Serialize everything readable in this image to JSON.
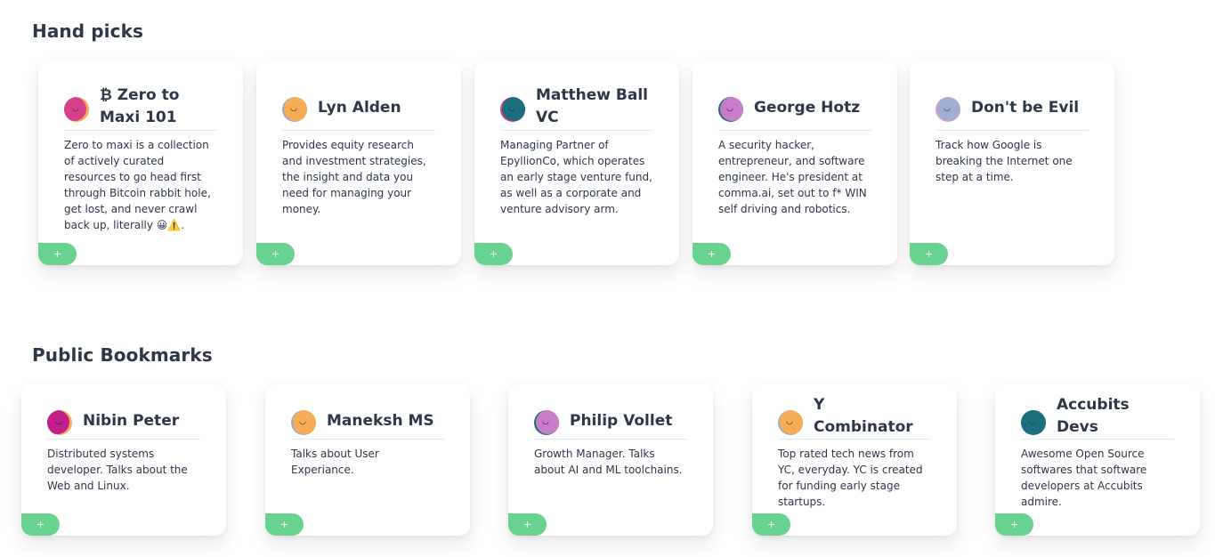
{
  "sections": {
    "hand_picks": {
      "title": "Hand picks",
      "cards": [
        {
          "title": "₿ Zero to Maxi 101",
          "desc": "Zero to maxi is a collection of actively curated resources to go head first through Bitcoin rabbit hole, get lost, and never crawl back up, literally 😀⚠️.",
          "add_label": "+",
          "avatar_color": "#d53f8c",
          "avatar_bg": "#f6ad55",
          "avatar_icon": "smiley-blob"
        },
        {
          "title": "Lyn Alden",
          "desc": "Provides equity research and investment strategies, the insight and data you need for managing your money.",
          "add_label": "+",
          "avatar_color": "#f6ad55",
          "avatar_bg": "#a0aec0",
          "avatar_icon": "smiley-blob"
        },
        {
          "title": "Matthew Ball VC",
          "desc": "Managing Partner of EpyllionCo, which operates an early stage venture fund, as well as a corporate and venture advisory arm.",
          "add_label": "+",
          "avatar_color": "#1a6e7e",
          "avatar_bg": "#d53f8c",
          "avatar_icon": "smiley-blob"
        },
        {
          "title": "George Hotz",
          "desc": "A security hacker, entrepreneur, and software engineer. He's president at comma.ai, set out to f* WIN self driving and robotics.",
          "add_label": "+",
          "avatar_color": "#c77dca",
          "avatar_bg": "#1a6e7e",
          "avatar_icon": "smiley-blob"
        },
        {
          "title": "Don't be Evil",
          "desc": "Track how Google is breaking the Internet one step at a time.",
          "add_label": "+",
          "avatar_color": "#a3aed6",
          "avatar_bg": "#d6a3d0",
          "avatar_icon": "smiley-blob"
        }
      ]
    },
    "public_bookmarks": {
      "title": "Public Bookmarks",
      "cards": [
        {
          "title": "Nibin Peter",
          "desc": "Distributed systems developer. Talks about the Web and Linux.",
          "add_label": "+",
          "avatar_color": "#c21e8c",
          "avatar_bg": "#f6ad55",
          "avatar_icon": "smiley-blob"
        },
        {
          "title": "Maneksh MS",
          "desc": "Talks about User Experiance.",
          "add_label": "+",
          "avatar_color": "#f6ad55",
          "avatar_bg": "#a0aec0",
          "avatar_icon": "smiley-blob"
        },
        {
          "title": "Philip Vollet",
          "desc": "Growth Manager. Talks about AI and ML toolchains.",
          "add_label": "+",
          "avatar_color": "#c77dca",
          "avatar_bg": "#1a6e7e",
          "avatar_icon": "smiley-blob"
        },
        {
          "title": "Y Combinator",
          "desc": "Top rated tech news from YC, everyday. YC is created for funding early stage startups.",
          "add_label": "+",
          "avatar_color": "#f6ad55",
          "avatar_bg": "#a0aec0",
          "avatar_icon": "smiley-blob"
        },
        {
          "title": "Accubits Devs",
          "desc": "Awesome Open Source softwares that software developers at Accubits admire.",
          "add_label": "+",
          "avatar_color": "#1a6e7e",
          "avatar_bg": "#1a6e7e",
          "avatar_icon": "smiley-blob"
        }
      ]
    }
  }
}
